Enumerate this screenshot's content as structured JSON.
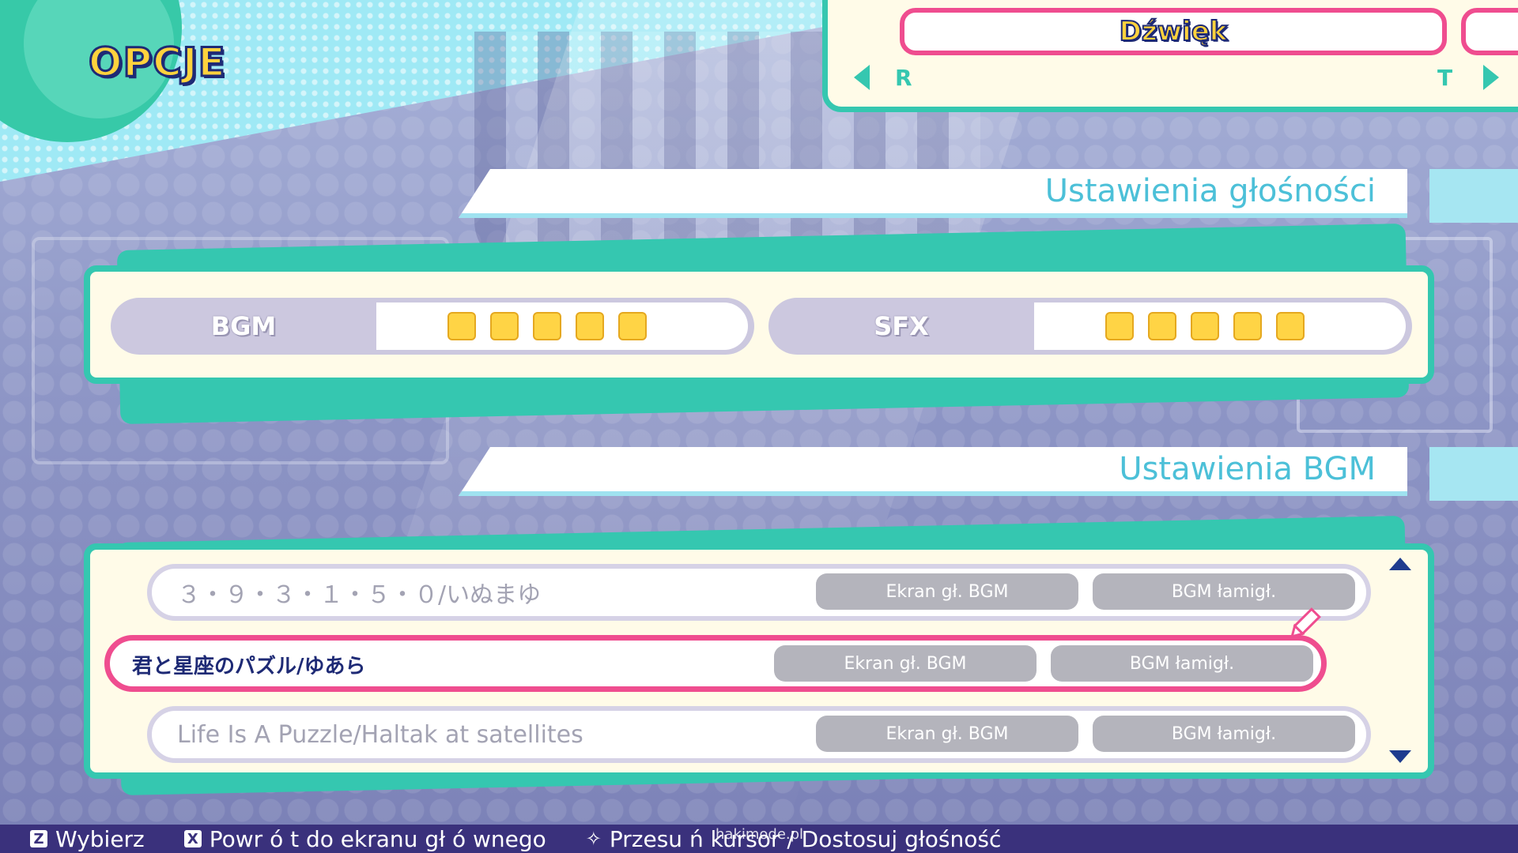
{
  "screen": {
    "title": "OPCJE",
    "category_tab": {
      "current": "Dźwięk",
      "prev_key": "R",
      "next_key": "T"
    }
  },
  "volume_section": {
    "heading": "Ustawienia głośności",
    "controls": [
      {
        "label": "BGM",
        "level": 5,
        "max": 5
      },
      {
        "label": "SFX",
        "level": 5,
        "max": 5
      }
    ]
  },
  "bgm_section": {
    "heading": "Ustawienia BGM",
    "tracks": [
      {
        "title": "３・９・３・１・５・０/いぬまゆ",
        "button_main": "Ekran gł. BGM",
        "button_puzzle": "BGM łamigł.",
        "selected": false
      },
      {
        "title": "君と星座のパズル/ゆあら",
        "button_main": "Ekran gł. BGM",
        "button_puzzle": "BGM łamigł.",
        "selected": true
      },
      {
        "title": "Life Is A Puzzle/Haltak at satellites",
        "button_main": "Ekran gł. BGM",
        "button_puzzle": "BGM łamigł.",
        "selected": false
      }
    ]
  },
  "help_bar": {
    "select_key": "Z",
    "select_label": "Wybierz",
    "back_key": "X",
    "back_label": "Powr ó t do ekranu gł ó wnego",
    "move_label": "Przesu ń  kursor / Dostosuj głośność"
  },
  "watermark": "hakimode.pl",
  "colors": {
    "accent_teal": "#35c7b0",
    "selection_pink": "#ef4d8f",
    "volume_yellow": "#ffd445",
    "heading_cyan": "#4cc0d8",
    "help_bar": "#3a317c"
  }
}
